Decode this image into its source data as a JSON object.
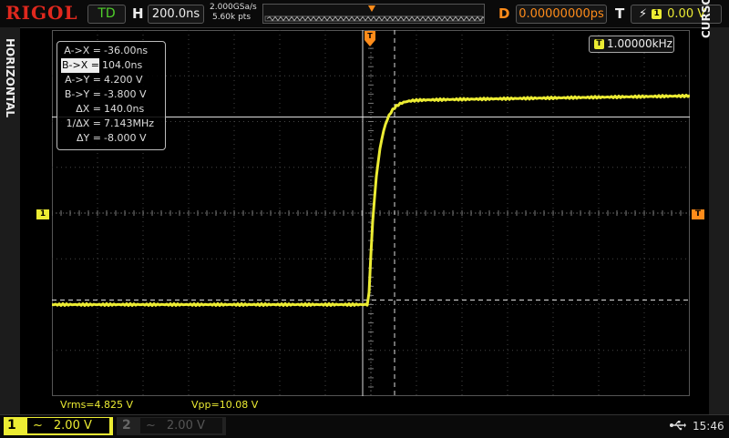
{
  "brand": "RIGOL",
  "header": {
    "trigger_status": "TD",
    "h_label": "H",
    "timebase": "200.0ns",
    "sample_rate": "2.000GSa/s",
    "memory_depth": "5.60k pts",
    "d_label": "D",
    "delay": "0.00000000ps",
    "t_label": "T",
    "trigger_source": "1",
    "trigger_level": "0.00 V"
  },
  "side_tabs": {
    "left": "HORIZONTAL",
    "right": "CURSOR"
  },
  "cursor_table": [
    {
      "key": "A->X =",
      "value": "-36.00ns",
      "selected": false
    },
    {
      "key": "B->X =",
      "value": "104.0ns",
      "selected": true
    },
    {
      "key": "A->Y =",
      "value": "4.200 V",
      "selected": false
    },
    {
      "key": "B->Y =",
      "value": "-3.800 V",
      "selected": false
    },
    {
      "key": "ΔX =",
      "value": "140.0ns",
      "selected": false
    },
    {
      "key": "1/ΔX =",
      "value": "7.143MHz",
      "selected": false
    },
    {
      "key": "ΔY =",
      "value": "-8.000 V",
      "selected": false
    }
  ],
  "frequency": {
    "icon": "T",
    "value": "1.00000kHz"
  },
  "measurements": {
    "vrms": "Vrms=4.825 V",
    "vpp": "Vpp=10.08 V"
  },
  "markers": {
    "channel": "1",
    "trigger": "T"
  },
  "channels": [
    {
      "number": "1",
      "coupling": "~",
      "scale": "2.00 V",
      "active": true
    },
    {
      "number": "2",
      "coupling": "~",
      "scale": "2.00 V",
      "active": false
    }
  ],
  "status": {
    "usb_icon": "usb-icon",
    "time": "15:46"
  },
  "colors": {
    "ch1": "#ecec33",
    "trigger": "#ff8c1a",
    "brand": "#e0281e",
    "td": "#4fd02a"
  },
  "waveform": {
    "time_per_div_ns": 200,
    "volts_per_div": 2.0,
    "low_level_v": -4.0,
    "high_level_v": 4.95,
    "edge_start_ns": -10,
    "rise_tau_ns": 35
  },
  "cursors": {
    "ax_ns": -36.0,
    "bx_ns": 104.0,
    "ay_v": 4.2,
    "by_v": -3.8
  }
}
